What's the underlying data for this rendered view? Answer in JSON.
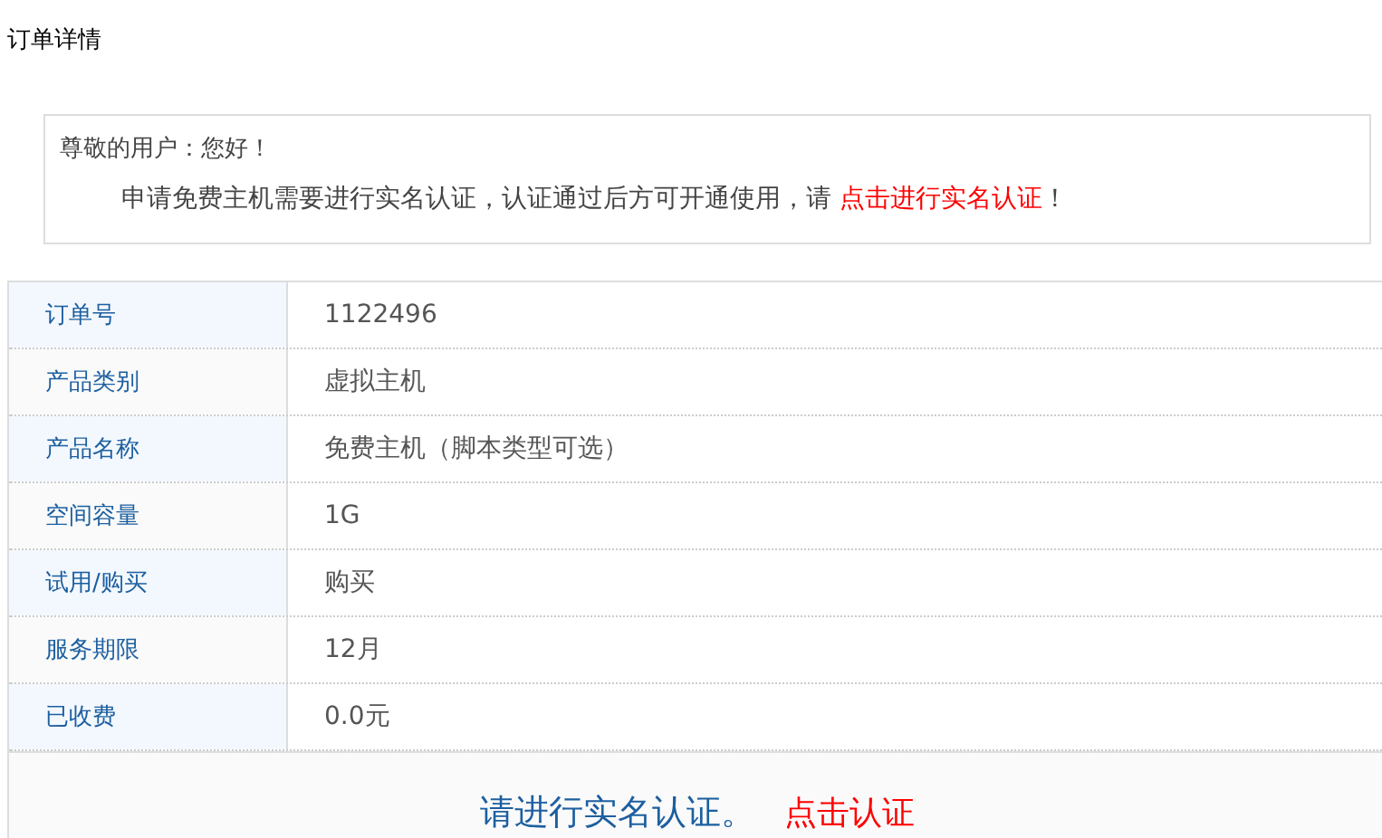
{
  "page_title": "订单详情",
  "notice": {
    "greeting": "尊敬的用户：您好！",
    "message": "申请免费主机需要进行实名认证，认证通过后方可开通使用，请 ",
    "link": "点击进行实名认证",
    "message_end": "！"
  },
  "details": [
    {
      "label": "订单号",
      "value": "1122496"
    },
    {
      "label": "产品类别",
      "value": "虚拟主机"
    },
    {
      "label": "产品名称",
      "value": "免费主机（脚本类型可选）"
    },
    {
      "label": "空间容量",
      "value": "1G"
    },
    {
      "label": "试用/购买",
      "value": "购买"
    },
    {
      "label": "服务期限",
      "value": "12月"
    },
    {
      "label": "已收费",
      "value": "0.0元"
    }
  ],
  "footer": {
    "prompt": "请进行实名认证。",
    "link": "点击认证"
  }
}
